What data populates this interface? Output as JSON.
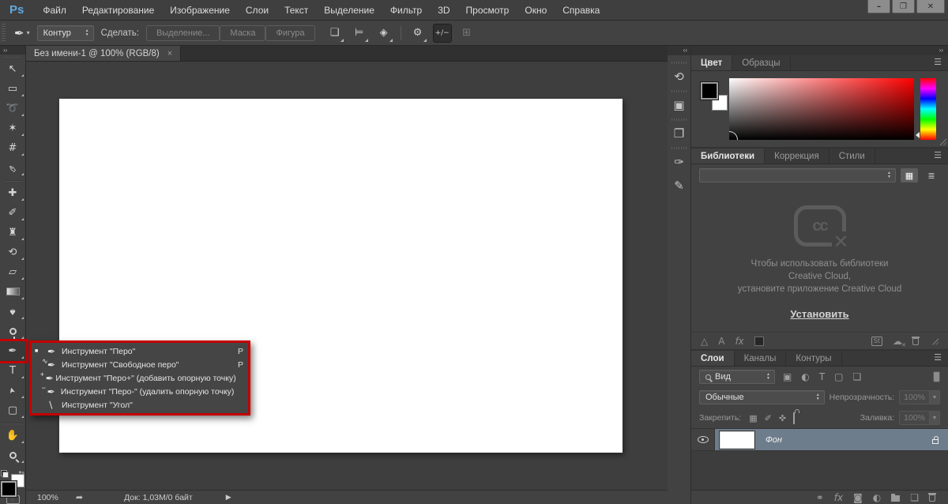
{
  "window": {
    "logo": "Ps",
    "controls": [
      {
        "name": "minimize-button",
        "glyph": "–"
      },
      {
        "name": "restore-button",
        "glyph": "❐"
      },
      {
        "name": "close-button",
        "glyph": "✕"
      }
    ]
  },
  "menu": {
    "items": [
      "Файл",
      "Редактирование",
      "Изображение",
      "Слои",
      "Текст",
      "Выделение",
      "Фильтр",
      "3D",
      "Просмотр",
      "Окно",
      "Справка"
    ]
  },
  "options": {
    "tool_glyph": "✒",
    "caret": "▾",
    "preset": "Контур",
    "make_label": "Сделать:",
    "buttons": [
      {
        "name": "make-selection-button",
        "label": "Выделение..."
      },
      {
        "name": "make-mask-button",
        "label": "Маска"
      },
      {
        "name": "make-shape-button",
        "label": "Фигура"
      }
    ],
    "icons": [
      {
        "name": "path-operations-icon",
        "glyph": "❏",
        "cls": "fo"
      },
      {
        "name": "path-align-icon",
        "glyph": "⊨",
        "cls": "fo"
      },
      {
        "name": "path-arrange-icon",
        "glyph": "◈",
        "cls": "fo"
      },
      {
        "name": "options-separator",
        "glyph": "",
        "cls": "vsep"
      },
      {
        "name": "geometry-options-icon",
        "glyph": "⚙",
        "cls": "fo"
      },
      {
        "name": "auto-add-delete-icon",
        "glyph": "+/−",
        "cls": "pressed"
      },
      {
        "name": "edit-toolbar-icon",
        "glyph": "⊞",
        "cls": "disabled"
      }
    ]
  },
  "document_tab": {
    "title": "Без имени-1 @ 100% (RGB/8)",
    "close": "×"
  },
  "toolbar": {
    "collapse": "››",
    "tools": [
      {
        "name": "move-tool",
        "glyph": "↖"
      },
      {
        "name": "marquee-tool",
        "glyph": "▭"
      },
      {
        "name": "lasso-tool",
        "glyph": "➰"
      },
      {
        "name": "magic-wand-tool",
        "glyph": "✶"
      },
      {
        "name": "crop-tool",
        "glyph": "#"
      },
      {
        "name": "eyedropper-tool",
        "glyph": "✑",
        "cls": "rot45"
      },
      {
        "name": "separator",
        "glyph": "",
        "cls": "sep"
      },
      {
        "name": "healing-brush-tool",
        "glyph": "✚"
      },
      {
        "name": "brush-tool",
        "glyph": "✐"
      },
      {
        "name": "clone-stamp-tool",
        "glyph": "♜"
      },
      {
        "name": "history-brush-tool",
        "glyph": "⟲"
      },
      {
        "name": "eraser-tool",
        "glyph": "▱"
      },
      {
        "name": "gradient-tool",
        "glyph": "",
        "cls": "grad"
      },
      {
        "name": "blur-tool",
        "glyph": "♠",
        "cls": "rot180"
      },
      {
        "name": "dodge-tool",
        "glyph": "",
        "cls": "lens"
      },
      {
        "name": "pen-tool",
        "glyph": "✒",
        "cls": "red-ring"
      },
      {
        "name": "type-tool",
        "glyph": "T"
      },
      {
        "name": "path-selection-tool",
        "glyph": "➤",
        "cls": "rotM90"
      },
      {
        "name": "rectangle-tool",
        "glyph": "▢"
      },
      {
        "name": "separator",
        "glyph": "",
        "cls": "sep"
      },
      {
        "name": "hand-tool",
        "glyph": "✋"
      },
      {
        "name": "zoom-tool",
        "glyph": "",
        "cls": "lens lens-diag"
      }
    ],
    "swap_glyph": "⇆"
  },
  "flyout": {
    "items": [
      {
        "name": "pen-tool-item",
        "marker": "■",
        "badge": "",
        "glyph": "✒",
        "label": "Инструмент \"Перо\"",
        "key": "P"
      },
      {
        "name": "freeform-pen-tool-item",
        "marker": "",
        "badge": "∿",
        "glyph": "✒",
        "label": "Инструмент \"Свободное перо\"",
        "key": "P"
      },
      {
        "name": "add-anchor-tool-item",
        "marker": "",
        "badge": "+",
        "glyph": "✒",
        "label": "Инструмент \"Перо+\" (добавить опорную точку)",
        "key": ""
      },
      {
        "name": "delete-anchor-tool-item",
        "marker": "",
        "badge": "−",
        "glyph": "✒",
        "label": "Инструмент \"Перо-\" (удалить опорную точку)",
        "key": ""
      },
      {
        "name": "convert-point-tool-item",
        "marker": "",
        "badge": "",
        "glyph": "∖",
        "label": "Инструмент \"Угол\"",
        "key": ""
      }
    ]
  },
  "status": {
    "zoom": "100%",
    "export_glyph": "➦",
    "doc": "Док: 1,03М/0 байт",
    "arrow": "▶"
  },
  "dock": {
    "expand": "‹‹",
    "icons": [
      {
        "name": "history-panel-icon",
        "glyph": "⟲",
        "cls": ""
      },
      {
        "name": "properties-panel-icon",
        "glyph": "▣",
        "cls": ""
      },
      {
        "name": "info-panel-icon",
        "glyph": "❐",
        "cls": ""
      },
      {
        "name": "brushes-panel-icon",
        "glyph": "✑",
        "cls": ""
      },
      {
        "name": "tool-presets-panel-icon",
        "glyph": "✎",
        "cls": "nogrip"
      }
    ]
  },
  "panels": {
    "collapse": "››",
    "color": {
      "tabs": [
        {
          "label": "Цвет",
          "cls": "active"
        },
        {
          "label": "Образцы",
          "cls": ""
        }
      ],
      "menu": "☰"
    },
    "libraries": {
      "tabs": [
        {
          "label": "Библиотеки",
          "cls": "active"
        },
        {
          "label": "Коррекция",
          "cls": ""
        },
        {
          "label": "Стили",
          "cls": ""
        }
      ],
      "menu": "☰",
      "view_grid": "▦",
      "view_list": "≣",
      "cc_letters": "cc",
      "cc_cross": "✕",
      "message": [
        "Чтобы использовать библиотеки",
        "Creative Cloud,",
        "установите приложение Creative Cloud"
      ],
      "install": "Установить",
      "footer_left": [
        {
          "name": "add-graphic-icon",
          "glyph": "△",
          "cls": ""
        },
        {
          "name": "add-char-style-icon",
          "glyph": "A",
          "cls": ""
        },
        {
          "name": "add-layer-style-icon",
          "glyph": "fx",
          "cls": "fx"
        },
        {
          "name": "add-color-icon",
          "glyph": "",
          "cls": "swatch"
        }
      ],
      "footer_right": [
        {
          "name": "adobe-stock-icon",
          "glyph": "St",
          "cls": "boxed"
        },
        {
          "name": "cc-sync-icon",
          "glyph": "☁",
          "cls": "cc-x"
        },
        {
          "name": "library-trash-icon",
          "glyph": "",
          "cls": "trash"
        }
      ]
    },
    "layers": {
      "tabs": [
        {
          "label": "Слои",
          "cls": "active"
        },
        {
          "label": "Каналы",
          "cls": ""
        },
        {
          "label": "Контуры",
          "cls": ""
        }
      ],
      "menu": "☰",
      "search": "Вид",
      "filters": [
        {
          "name": "filter-image-icon",
          "glyph": "▣"
        },
        {
          "name": "filter-adjustment-icon",
          "glyph": "◐"
        },
        {
          "name": "filter-type-icon",
          "glyph": "T"
        },
        {
          "name": "filter-shape-icon",
          "glyph": "▢"
        },
        {
          "name": "filter-smart-object-icon",
          "glyph": "❏"
        }
      ],
      "blend": "Обычные",
      "opacity_label": "Непрозрачность:",
      "opacity": "100%",
      "dropdown_glyph": "▼",
      "lock_label": "Закрепить:",
      "locks": [
        {
          "name": "lock-transparency-icon",
          "glyph": "▦",
          "cls": ""
        },
        {
          "name": "lock-paint-icon",
          "glyph": "✐",
          "cls": ""
        },
        {
          "name": "lock-position-icon",
          "glyph": "✜",
          "cls": ""
        },
        {
          "name": "lock-all-icon",
          "glyph": "",
          "cls": "lock"
        }
      ],
      "fill_label": "Заливка:",
      "fill": "100%",
      "layer_name": "Фон",
      "footer": [
        {
          "name": "link-layers-icon",
          "glyph": "⚭",
          "cls": ""
        },
        {
          "name": "layer-style-icon",
          "glyph": "fx",
          "cls": "fx"
        },
        {
          "name": "add-mask-icon",
          "glyph": "◙",
          "cls": ""
        },
        {
          "name": "adjustment-layer-icon",
          "glyph": "◐",
          "cls": ""
        },
        {
          "name": "new-group-icon",
          "glyph": "",
          "cls": "folder"
        },
        {
          "name": "new-layer-icon",
          "glyph": "❏",
          "cls": ""
        },
        {
          "name": "delete-layer-icon",
          "glyph": "",
          "cls": "trash"
        }
      ]
    }
  }
}
